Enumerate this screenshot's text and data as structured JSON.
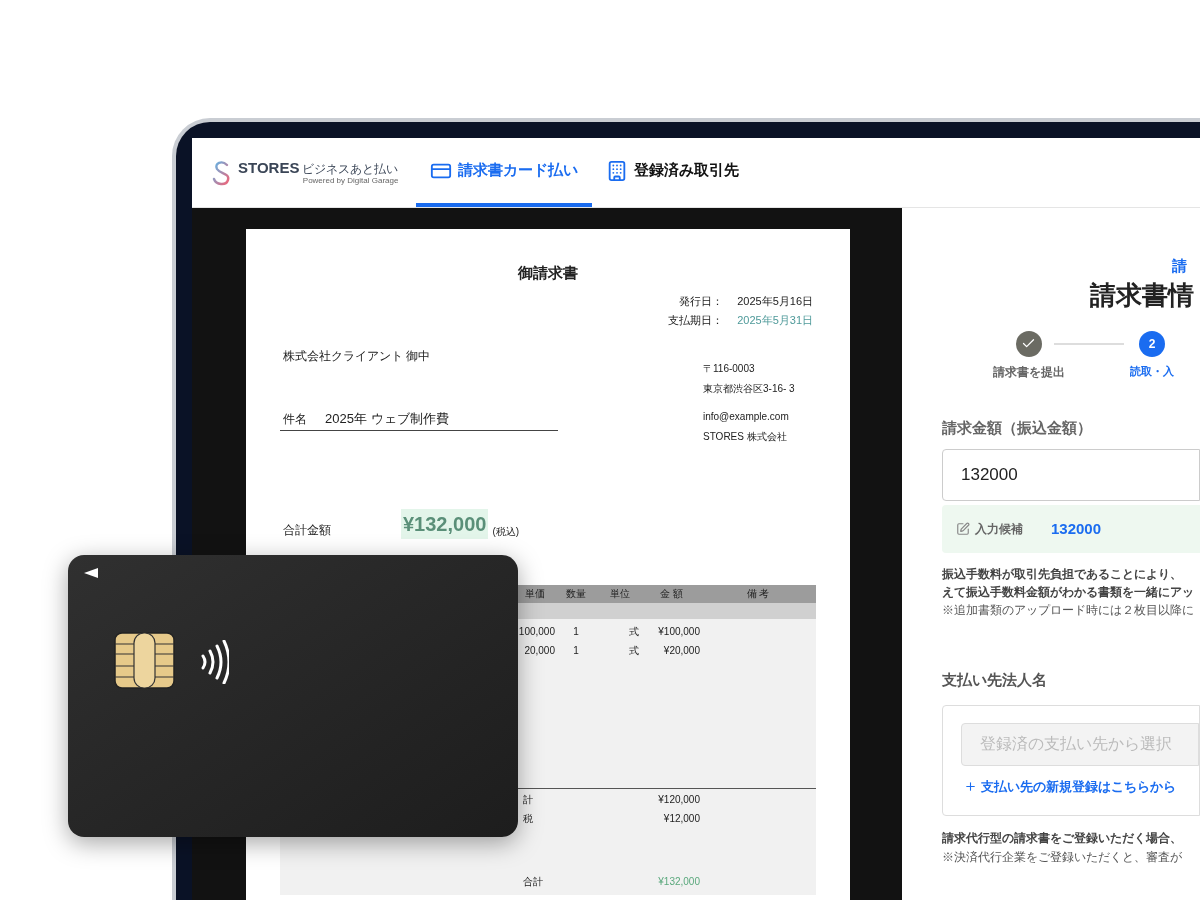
{
  "header": {
    "logo": {
      "name": "STORES",
      "tagline": "ビジネスあと払い",
      "powered_by": "Powered by Digital Garage"
    },
    "tabs": [
      {
        "label": "請求書カード払い",
        "selected": true
      },
      {
        "label": "登録済み取引先",
        "selected": false
      }
    ]
  },
  "invoice": {
    "title": "御請求書",
    "dates": [
      {
        "label": "発行日：",
        "value": "2025年5月16日",
        "highlight": false
      },
      {
        "label": "支払期日：",
        "value": "2025年5月31日",
        "highlight": true
      }
    ],
    "client": "株式会社クライアント 御中",
    "sender": [
      "〒116-0003",
      "東京都渋谷区3-16- 3"
    ],
    "contact": [
      "info@example.com",
      "STORES 株式会社"
    ],
    "subject_label": "件名",
    "subject": "2025年 ウェブ制作費",
    "total_label": "合計金額",
    "total": "¥132,000",
    "tax_note": "(税込)",
    "table": {
      "columns": [
        "単価",
        "数量",
        "単位",
        "金 額",
        "備 考"
      ],
      "rows": [
        {
          "unit_price": "100,000",
          "quantity": "1",
          "unit": "式",
          "amount": "¥100,000"
        },
        {
          "unit_price": "20,000",
          "quantity": "1",
          "unit": "式",
          "amount": "¥20,000"
        }
      ],
      "summary": [
        {
          "label": "計",
          "amount": "¥120,000",
          "highlight": false
        },
        {
          "label": "税",
          "amount": "¥12,000",
          "highlight": false
        },
        {
          "label": "合計",
          "amount": "¥132,000",
          "highlight": true
        }
      ]
    }
  },
  "form": {
    "subtitle": "請",
    "title": "請求書情",
    "steps": [
      {
        "label": "請求書を提出",
        "done": true,
        "current": false
      },
      {
        "label": "読取・入",
        "number": "2",
        "done": false,
        "current": true
      }
    ],
    "amount": {
      "label": "請求金額（振込金額）",
      "value": "132000",
      "suggestion_label": "入力候補",
      "suggestion": "132000"
    },
    "amount_notes": [
      {
        "text": "振込手数料が取引先負担であることにより、",
        "bold": true
      },
      {
        "text": "えて振込手数料金額がわかる書類を一緒にアッ",
        "bold": true
      },
      {
        "text": "※追加書類のアップロード時には２枚目以降に",
        "bold": false
      }
    ],
    "payee": {
      "label": "支払い先法人名",
      "placeholder": "登録済の支払い先から選択",
      "link": "支払い先の新規登録はこちらから"
    },
    "payee_notes": [
      {
        "text": "請求代行型の請求書をご登録いただく場合、",
        "bold": true
      },
      {
        "text": "※決済代行企業をご登録いただくと、審査が",
        "bold": false
      }
    ]
  }
}
